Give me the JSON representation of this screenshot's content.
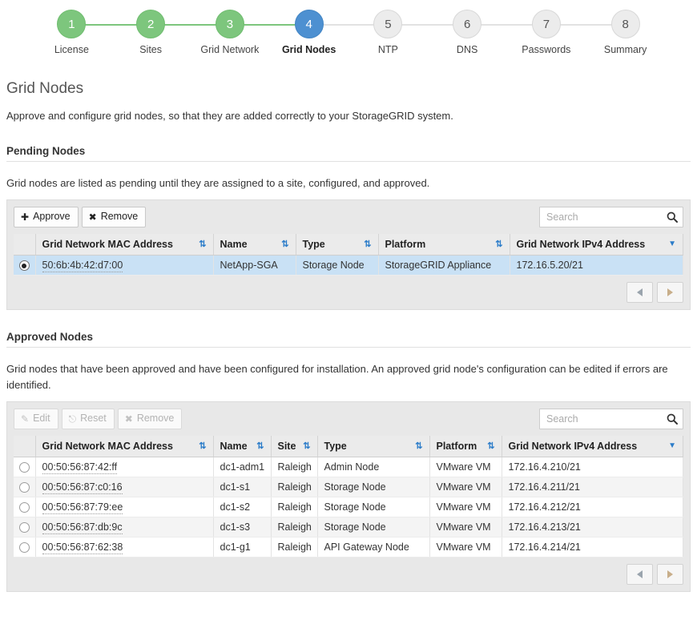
{
  "wizard": {
    "steps": [
      {
        "number": "1",
        "label": "License",
        "state": "done"
      },
      {
        "number": "2",
        "label": "Sites",
        "state": "done"
      },
      {
        "number": "3",
        "label": "Grid Network",
        "state": "done"
      },
      {
        "number": "4",
        "label": "Grid Nodes",
        "state": "current"
      },
      {
        "number": "5",
        "label": "NTP",
        "state": "todo"
      },
      {
        "number": "6",
        "label": "DNS",
        "state": "todo"
      },
      {
        "number": "7",
        "label": "Passwords",
        "state": "todo"
      },
      {
        "number": "8",
        "label": "Summary",
        "state": "todo"
      }
    ],
    "colors": {
      "done": "#7dc67d",
      "current": "#4d90d1",
      "todo": "#ececec"
    }
  },
  "page": {
    "title": "Grid Nodes",
    "description": "Approve and configure grid nodes, so that they are added correctly to your StorageGRID system."
  },
  "pending": {
    "section_title": "Pending Nodes",
    "description": "Grid nodes are listed as pending until they are assigned to a site, configured, and approved.",
    "toolbar": {
      "approve_label": "Approve",
      "approve_icon": "plus-icon",
      "remove_label": "Remove",
      "remove_icon": "x-icon"
    },
    "search": {
      "placeholder": "Search",
      "value": "",
      "icon": "search-icon"
    },
    "columns": [
      {
        "label": "Grid Network MAC Address",
        "sort": "updown"
      },
      {
        "label": "Name",
        "sort": "updown"
      },
      {
        "label": "Type",
        "sort": "updown"
      },
      {
        "label": "Platform",
        "sort": "updown"
      },
      {
        "label": "Grid Network IPv4 Address",
        "sort": "caret-down"
      }
    ],
    "rows": [
      {
        "selected": true,
        "mac": "50:6b:4b:42:d7:00",
        "name": "NetApp-SGA",
        "type": "Storage Node",
        "platform": "StorageGRID Appliance",
        "ipv4": "172.16.5.20/21"
      }
    ],
    "pager": {
      "prev_icon": "triangle-left-icon",
      "next_icon": "triangle-right-icon"
    }
  },
  "approved": {
    "section_title": "Approved Nodes",
    "description": "Grid nodes that have been approved and have been configured for installation. An approved grid node's configuration can be edited if errors are identified.",
    "toolbar": {
      "edit_label": "Edit",
      "edit_icon": "pencil-icon",
      "edit_disabled": true,
      "reset_label": "Reset",
      "reset_icon": "eraser-icon",
      "reset_disabled": true,
      "remove_label": "Remove",
      "remove_icon": "x-icon",
      "remove_disabled": true
    },
    "search": {
      "placeholder": "Search",
      "value": "",
      "icon": "search-icon"
    },
    "columns": [
      {
        "label": "Grid Network MAC Address",
        "sort": "updown"
      },
      {
        "label": "Name",
        "sort": "updown"
      },
      {
        "label": "Site",
        "sort": "updown"
      },
      {
        "label": "Type",
        "sort": "updown"
      },
      {
        "label": "Platform",
        "sort": "updown"
      },
      {
        "label": "Grid Network IPv4 Address",
        "sort": "caret-down"
      }
    ],
    "rows": [
      {
        "selected": false,
        "mac": "00:50:56:87:42:ff",
        "name": "dc1-adm1",
        "site": "Raleigh",
        "type": "Admin Node",
        "platform": "VMware VM",
        "ipv4": "172.16.4.210/21"
      },
      {
        "selected": false,
        "mac": "00:50:56:87:c0:16",
        "name": "dc1-s1",
        "site": "Raleigh",
        "type": "Storage Node",
        "platform": "VMware VM",
        "ipv4": "172.16.4.211/21"
      },
      {
        "selected": false,
        "mac": "00:50:56:87:79:ee",
        "name": "dc1-s2",
        "site": "Raleigh",
        "type": "Storage Node",
        "platform": "VMware VM",
        "ipv4": "172.16.4.212/21"
      },
      {
        "selected": false,
        "mac": "00:50:56:87:db:9c",
        "name": "dc1-s3",
        "site": "Raleigh",
        "type": "Storage Node",
        "platform": "VMware VM",
        "ipv4": "172.16.4.213/21"
      },
      {
        "selected": false,
        "mac": "00:50:56:87:62:38",
        "name": "dc1-g1",
        "site": "Raleigh",
        "type": "API Gateway Node",
        "platform": "VMware VM",
        "ipv4": "172.16.4.214/21"
      }
    ],
    "pager": {
      "prev_icon": "triangle-left-icon",
      "next_icon": "triangle-right-icon"
    }
  }
}
